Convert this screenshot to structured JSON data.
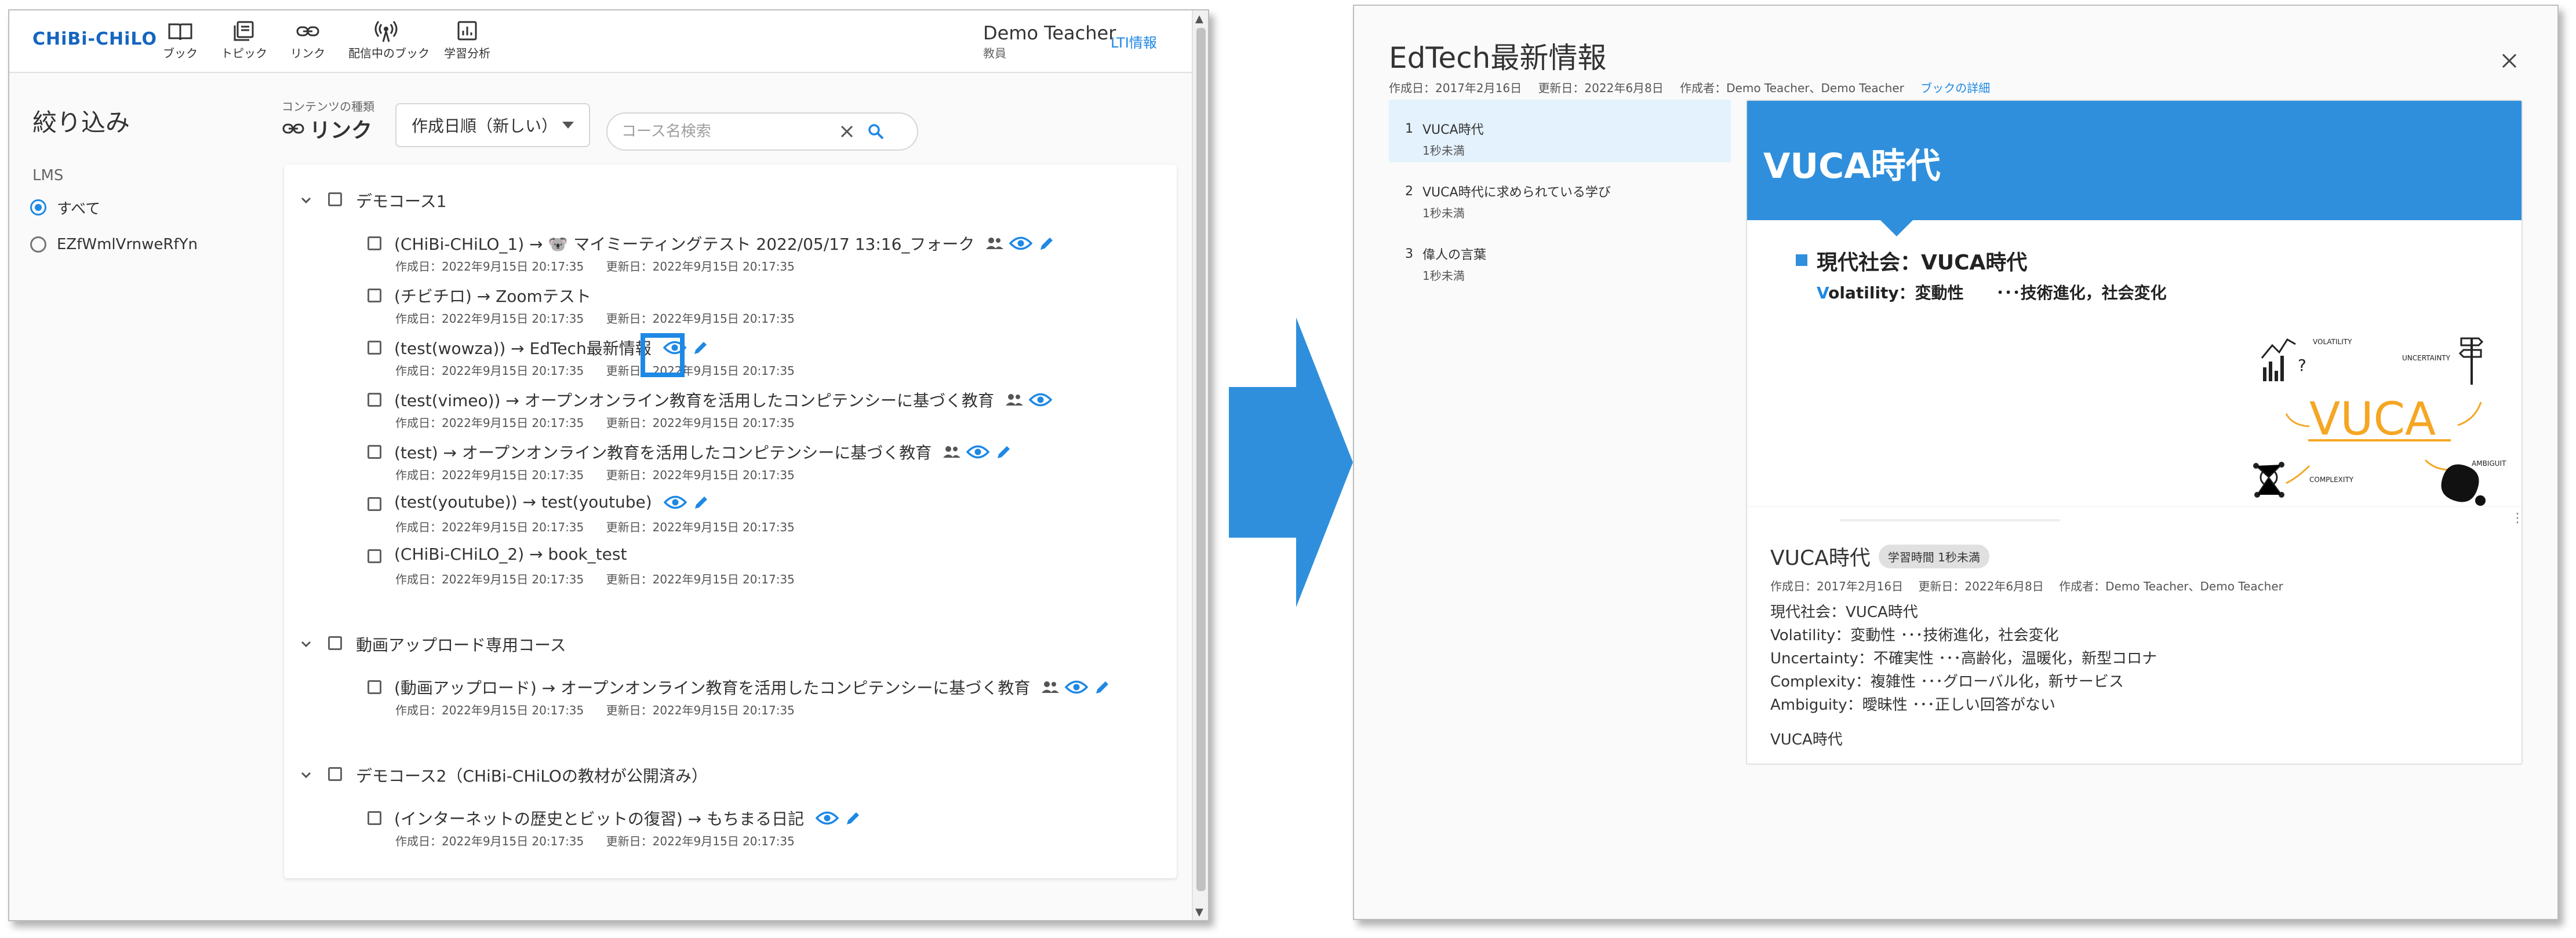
{
  "app": {
    "logo": "CHiBi-CHiLO",
    "nav": [
      {
        "label": "ブック",
        "icon": "book-icon"
      },
      {
        "label": "トピック",
        "icon": "topic-icon"
      },
      {
        "label": "リンク",
        "icon": "link-icon"
      },
      {
        "label": "配信中のブック",
        "icon": "broadcast-icon"
      },
      {
        "label": "学習分析",
        "icon": "analytics-icon"
      }
    ],
    "user": {
      "name": "Demo Teacher",
      "role": "教員"
    },
    "lti_link": "LTI情報"
  },
  "filter": {
    "title": "絞り込み",
    "lms_label": "LMS",
    "options": [
      {
        "label": "すべて",
        "checked": true
      },
      {
        "label": "EZfWmlVrnweRfYn",
        "checked": false
      }
    ]
  },
  "toolbar": {
    "content_type_caption": "コンテンツの種類",
    "content_type": "リンク",
    "sort": "作成日順（新しい）",
    "search_placeholder": "コース名検索"
  },
  "courses": [
    {
      "name": "デモコース1",
      "items": [
        {
          "title": "(CHiBi-CHiLO_1) → 🐨 マイミーティングテスト 2022/05/17 13:16_フォーク",
          "shared": true,
          "view": true,
          "edit": true,
          "created": "作成日：2022年9月15日 20:17:35",
          "updated": "更新日：2022年9月15日 20:17:35"
        },
        {
          "title": "(チビチロ) → Zoomテスト",
          "shared": false,
          "view": false,
          "edit": false,
          "created": "作成日：2022年9月15日 20:17:35",
          "updated": "更新日：2022年9月15日 20:17:35"
        },
        {
          "title": "(test(wowza)) → EdTech最新情報",
          "shared": false,
          "view": true,
          "edit": true,
          "created": "作成日：2022年9月15日 20:17:35",
          "updated": "更新日：2022年9月15日 20:17:35"
        },
        {
          "title": "(test(vimeo)) → オープンオンライン教育を活用したコンピテンシーに基づく教育",
          "shared": true,
          "view": true,
          "edit": false,
          "created": "作成日：2022年9月15日 20:17:35",
          "updated": "更新日：2022年9月15日 20:17:35"
        },
        {
          "title": "(test) → オープンオンライン教育を活用したコンピテンシーに基づく教育",
          "shared": true,
          "view": true,
          "edit": true,
          "created": "作成日：2022年9月15日 20:17:35",
          "updated": "更新日：2022年9月15日 20:17:35"
        },
        {
          "title": "(test(youtube)) → test(youtube)",
          "shared": false,
          "view": true,
          "edit": true,
          "created": "作成日：2022年9月15日 20:17:35",
          "updated": "更新日：2022年9月15日 20:17:35"
        },
        {
          "title": "(CHiBi-CHiLO_2) → book_test",
          "shared": false,
          "view": false,
          "edit": false,
          "created": "作成日：2022年9月15日 20:17:35",
          "updated": "更新日：2022年9月15日 20:17:35"
        }
      ]
    },
    {
      "name": "動画アップロード専用コース",
      "items": [
        {
          "title": "(動画アップロード) → オープンオンライン教育を活用したコンピテンシーに基づく教育",
          "shared": true,
          "view": true,
          "edit": true,
          "created": "作成日：2022年9月15日 20:17:35",
          "updated": "更新日：2022年9月15日 20:17:35"
        }
      ]
    },
    {
      "name": "デモコース2（CHiBi-CHiLOの教材が公開済み）",
      "items": [
        {
          "title": "(インターネットの歴史とビットの復習) → もちまる日記",
          "shared": false,
          "view": true,
          "edit": true,
          "created": "作成日：2022年9月15日 20:17:35",
          "updated": "更新日：2022年9月15日 20:17:35"
        }
      ]
    }
  ],
  "book": {
    "title": "EdTech最新情報",
    "created": "作成日：2017年2月16日",
    "updated": "更新日：2022年6月8日",
    "authors": "作成者：Demo Teacher、Demo Teacher",
    "detail_link": "ブックの詳細",
    "toc": [
      {
        "num": "1",
        "title": "VUCA時代",
        "time": "1秒未満",
        "active": true
      },
      {
        "num": "2",
        "title": "VUCA時代に求められている学び",
        "time": "1秒未満",
        "active": false
      },
      {
        "num": "3",
        "title": "偉人の言葉",
        "time": "1秒未満",
        "active": false
      }
    ],
    "slide": {
      "title": "VUCA時代",
      "bullet": "現代社会：VUCA時代",
      "sub_lead": "V",
      "sub_rest": "olatility：変動性　　･･･技術進化，社会変化",
      "graphic_words": [
        "VOLATILITY",
        "UNCERTAINTY",
        "VUCA",
        "COMPLEXITY",
        "AMBIGUITY"
      ]
    },
    "section": {
      "title": "VUCA時代",
      "time_chip": "学習時間 1秒未満",
      "created": "作成日：2017年2月16日",
      "updated": "更新日：2022年6月8日",
      "authors": "作成者：Demo Teacher、Demo Teacher",
      "description": [
        "現代社会：VUCA時代",
        "Volatility：変動性 ･･･技術進化，社会変化",
        "Uncertainty：不確実性 ･･･高齢化，温暖化，新型コロナ",
        "Complexity：複雑性 ･･･グローバル化，新サービス",
        "Ambiguity：曖昧性 ･･･正しい回答がない"
      ],
      "footer": "VUCA時代"
    }
  },
  "colors": {
    "accent": "#1e88e5",
    "slide_blue": "#2f8fdc",
    "vuca_orange": "#f5a623"
  }
}
